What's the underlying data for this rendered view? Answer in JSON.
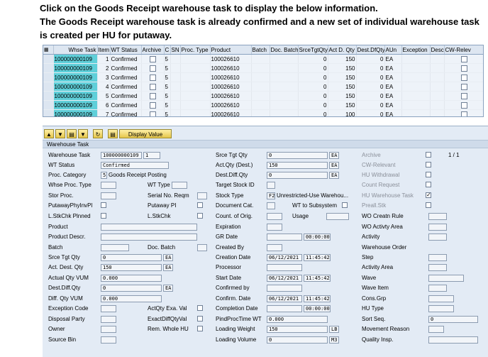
{
  "instructions": [
    "Click on the Goods Receipt warehouse task to display the below information.",
    "The Goods Receipt warehouse task is already confirmed and a new set of individual warehouse task",
    "is created per HU for putaway."
  ],
  "grid": {
    "columns": [
      "Whse Task",
      "Item",
      "WT Status",
      "Archive",
      "C",
      "SN",
      "Proc. Type",
      "Product",
      "Batch",
      "Doc. Batch",
      "SrceTgtQty",
      "Act D. Qty",
      "Dest.DfQty",
      "AUn",
      "Exception",
      "Desc.",
      "CW-Relev"
    ],
    "rows": [
      {
        "task": "100000000109",
        "item": "1",
        "status": "Confirmed",
        "c": "5",
        "product": "100026610",
        "srce": "0",
        "act": "150",
        "dest": "0",
        "aun": "EA"
      },
      {
        "task": "100000000109",
        "item": "2",
        "status": "Confirmed",
        "c": "5",
        "product": "100026610",
        "srce": "0",
        "act": "150",
        "dest": "0",
        "aun": "EA"
      },
      {
        "task": "100000000109",
        "item": "3",
        "status": "Confirmed",
        "c": "5",
        "product": "100026610",
        "srce": "0",
        "act": "150",
        "dest": "0",
        "aun": "EA"
      },
      {
        "task": "100000000109",
        "item": "4",
        "status": "Confirmed",
        "c": "5",
        "product": "100026610",
        "srce": "0",
        "act": "150",
        "dest": "0",
        "aun": "EA"
      },
      {
        "task": "100000000109",
        "item": "5",
        "status": "Confirmed",
        "c": "5",
        "product": "100026610",
        "srce": "0",
        "act": "150",
        "dest": "0",
        "aun": "EA"
      },
      {
        "task": "100000000109",
        "item": "6",
        "status": "Confirmed",
        "c": "5",
        "product": "100026610",
        "srce": "0",
        "act": "150",
        "dest": "0",
        "aun": "EA"
      },
      {
        "task": "100000000109",
        "item": "7",
        "status": "Confirmed",
        "c": "5",
        "product": "100026610",
        "srce": "0",
        "act": "100",
        "dest": "0",
        "aun": "EA"
      }
    ]
  },
  "toolbar": {
    "display_value": "Display Value"
  },
  "section_title": "Warehouse Task",
  "form": {
    "warehouse_task": "Warehouse Task",
    "warehouse_task_val": "100000000109",
    "warehouse_task_item": "1",
    "wt_status": "WT Status",
    "wt_status_val": "Confirmed",
    "proc_category": "Proc. Category",
    "proc_category_code": "5",
    "proc_category_val": "Goods Receipt Posting",
    "whse_proc_type": "Whse Proc. Type",
    "wt_type": "WT Type",
    "stor_proc": "Stor Proc.",
    "serial_no_reqm": "Serial No. Reqm",
    "putaway_phy_invpl": "PutawayPhyInvPl",
    "putaway_pi": "Putaway PI",
    "lstkchk_plnned": "L.StkChk Plnned",
    "lstkchk": "L.StkChk",
    "product": "Product",
    "product_descr": "Product Descr.",
    "batch": "Batch",
    "doc_batch": "Doc. Batch",
    "srce_tgt_qty_l": "Srce Tgt Qty",
    "srce_tgt_qty_l_val": "0",
    "srce_tgt_qty_l_unit": "EA",
    "act_dest_qty": "Act. Dest. Qty",
    "act_dest_qty_val": "150",
    "act_dest_qty_unit": "EA",
    "actual_qty_vum": "Actual Qty VUM",
    "actual_qty_vum_val": "0.000",
    "dest_diff_qty_l": "Dest.Diff.Qty",
    "dest_diff_qty_l_val": "0",
    "dest_diff_qty_l_unit": "EA",
    "diff_qty_vum": "Diff. Qty VUM",
    "diff_qty_vum_val": "0.000",
    "exception_code": "Exception Code",
    "actqty_exa_val": "ActQty Exa. Val",
    "disposal_party": "Disposal Party",
    "exactdiffqtyval": "ExactDiffQtyVal",
    "owner": "Owner",
    "rem_whole_hu": "Rem. Whole HU",
    "source_bin": "Source Bin",
    "srce_tgt_qty_m": "Srce Tgt Qty",
    "srce_tgt_qty_m_val": "0",
    "srce_tgt_qty_m_unit": "EA",
    "act_qty_dest": "Act.Qty (Dest.)",
    "act_qty_dest_val": "150",
    "act_qty_dest_unit": "EA",
    "dest_diff_qty_m": "Dest.Diff.Qty",
    "dest_diff_qty_m_val": "0",
    "dest_diff_qty_m_unit": "EA",
    "target_stock_id": "Target Stock ID",
    "stock_type": "Stock Type",
    "stock_type_code": "F2",
    "stock_type_val": "Unrestricted-Use Warehou...",
    "document_cat": "Document Cat.",
    "wt_to_subsystem": "WT to Subsystem",
    "count_of_orig": "Count. of Orig.",
    "usage": "Usage",
    "expiration": "Expiration",
    "gr_date": "GR Date",
    "gr_date_time": "00:00:00",
    "created_by": "Created By",
    "creation_date": "Creation Date",
    "creation_date_val": "06/12/2021",
    "creation_time": "11:45:42",
    "processor": "Processor",
    "start_date": "Start Date",
    "start_date_val": "06/12/2021",
    "start_time": "11:45:42",
    "confirmed_by": "Confirmed by",
    "confirm_date": "Confirm. Date",
    "confirm_date_val": "06/12/2021",
    "confirm_time": "11:45:42",
    "completion_date": "Completion Date",
    "completion_time": "00:00:00",
    "pindprocime_wt": "PindProcTime WT",
    "pindprocime_wt_val": "0.000",
    "loading_weight": "Loading Weight",
    "loading_weight_val": "150",
    "loading_weight_unit": "LB",
    "loading_volume": "Loading Volume",
    "loading_volume_val": "0",
    "loading_volume_unit": "M3",
    "archive": "Archive",
    "pager": "1 / 1",
    "cw_relevant": "CW-Relevant",
    "hu_withdrawal": "HU Withdrawal",
    "count_request": "Count Request",
    "hu_warehouse_task": "HU Warehouse Task",
    "prealloc_stk": "Preall.Stk",
    "wo_creatn_rule": "WO Creatn Rule",
    "wo_activty_area": "WO Activty Area",
    "activity": "Activity",
    "warehouse_order": "Warehouse Order",
    "step": "Step",
    "activity_area": "Activity Area",
    "wave": "Wave",
    "wave_item": "Wave Item",
    "cons_grp": "Cons.Grp",
    "hu_type": "HU Type",
    "sort_seq": "Sort Seq.",
    "sort_seq_val": "0",
    "movement_reason": "Movement Reason",
    "quality_insp": "Quality Insp."
  }
}
